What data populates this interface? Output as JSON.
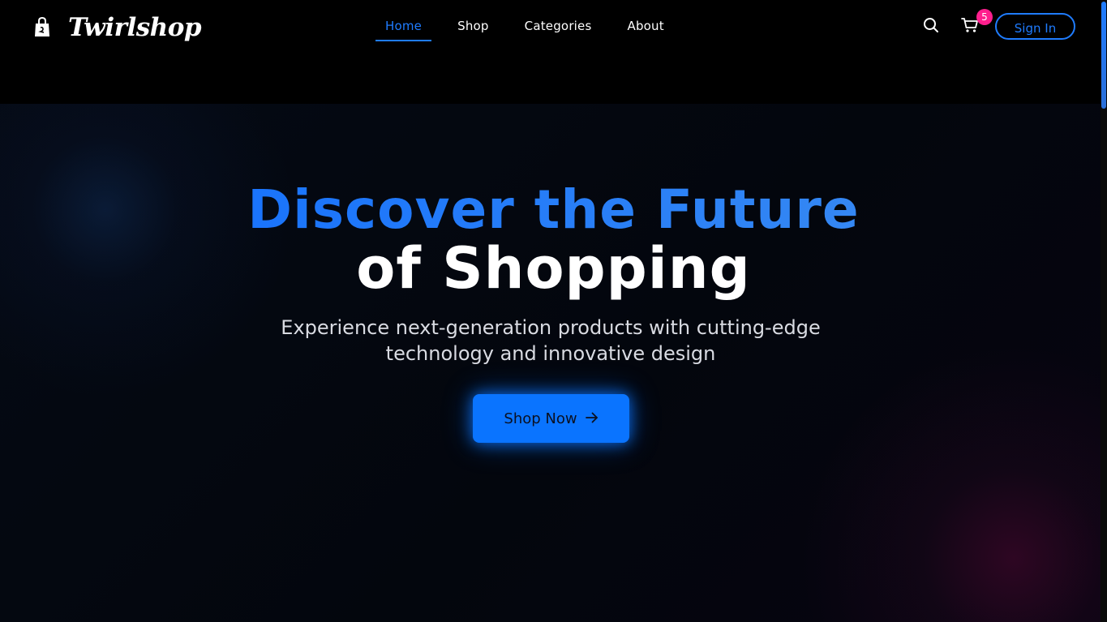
{
  "brand": {
    "name": "Twirlshop",
    "icon": "shopping-bag-icon"
  },
  "nav": {
    "items": [
      {
        "label": "Home",
        "active": true
      },
      {
        "label": "Shop",
        "active": false
      },
      {
        "label": "Categories",
        "active": false
      },
      {
        "label": "About",
        "active": false
      }
    ]
  },
  "actions": {
    "search_icon": "search-icon",
    "cart_icon": "cart-icon",
    "cart_count": "5",
    "signin_label": "Sign In"
  },
  "hero": {
    "title_line1": "Discover the Future",
    "title_line2": "of Shopping",
    "subtitle": "Experience next-generation products with cutting-edge technology and innovative design",
    "cta_label": "Shop Now",
    "cta_icon": "arrow-right-icon"
  },
  "colors": {
    "accent": "#1f7cff",
    "badge": "#ff1f8e",
    "background": "#000000"
  }
}
